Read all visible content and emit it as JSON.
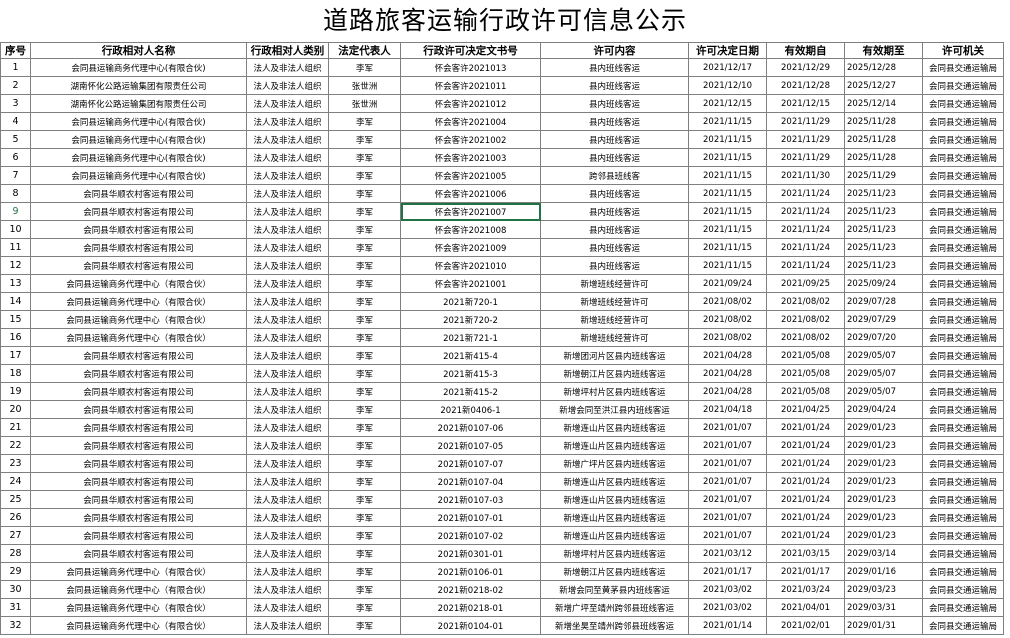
{
  "title": "道路旅客运输行政许可信息公示",
  "headers": [
    "序号",
    "行政相对人名称",
    "行政相对人类别",
    "法定代表人",
    "行政许可决定文书号",
    "许可内容",
    "许可决定日期",
    "有效期自",
    "有效期至",
    "许可机关"
  ],
  "rows": [
    [
      "1",
      "会同县运输商务代理中心(有限合伙)",
      "法人及非法人组织",
      "李军",
      "怀会客许2021013",
      "县内班线客运",
      "2021/12/17",
      "2021/12/29",
      "2025/12/28",
      "会同县交通运输局"
    ],
    [
      "2",
      "湖南怀化公路运输集团有限责任公司",
      "法人及非法人组织",
      "张世洲",
      "怀会客许2021011",
      "县内班线客运",
      "2021/12/10",
      "2021/12/28",
      "2025/12/27",
      "会同县交通运输局"
    ],
    [
      "3",
      "湖南怀化公路运输集团有限责任公司",
      "法人及非法人组织",
      "张世洲",
      "怀会客许2021012",
      "县内班线客运",
      "2021/12/15",
      "2021/12/15",
      "2025/12/14",
      "会同县交通运输局"
    ],
    [
      "4",
      "会同县运输商务代理中心(有限合伙)",
      "法人及非法人组织",
      "李军",
      "怀会客许2021004",
      "县内班线客运",
      "2021/11/15",
      "2021/11/29",
      "2025/11/28",
      "会同县交通运输局"
    ],
    [
      "5",
      "会同县运输商务代理中心(有限合伙)",
      "法人及非法人组织",
      "李军",
      "怀会客许2021002",
      "县内班线客运",
      "2021/11/15",
      "2021/11/29",
      "2025/11/28",
      "会同县交通运输局"
    ],
    [
      "6",
      "会同县运输商务代理中心(有限合伙)",
      "法人及非法人组织",
      "李军",
      "怀会客许2021003",
      "县内班线客运",
      "2021/11/15",
      "2021/11/29",
      "2025/11/28",
      "会同县交通运输局"
    ],
    [
      "7",
      "会同县运输商务代理中心(有限合伙)",
      "法人及非法人组织",
      "李军",
      "怀会客许2021005",
      "跨邻县班线客",
      "2021/11/15",
      "2021/11/30",
      "2025/11/29",
      "会同县交通运输局"
    ],
    [
      "8",
      "会同县华顺农村客运有限公司",
      "法人及非法人组织",
      "李军",
      "怀会客许2021006",
      "县内班线客运",
      "2021/11/15",
      "2021/11/24",
      "2025/11/23",
      "会同县交通运输局"
    ],
    [
      "9",
      "会同县华顺农村客运有限公司",
      "法人及非法人组织",
      "李军",
      "怀会客许2021007",
      "县内班线客运",
      "2021/11/15",
      "2021/11/24",
      "2025/11/23",
      "会同县交通运输局"
    ],
    [
      "10",
      "会同县华顺农村客运有限公司",
      "法人及非法人组织",
      "李军",
      "怀会客许2021008",
      "县内班线客运",
      "2021/11/15",
      "2021/11/24",
      "2025/11/23",
      "会同县交通运输局"
    ],
    [
      "11",
      "会同县华顺农村客运有限公司",
      "法人及非法人组织",
      "李军",
      "怀会客许2021009",
      "县内班线客运",
      "2021/11/15",
      "2021/11/24",
      "2025/11/23",
      "会同县交通运输局"
    ],
    [
      "12",
      "会同县华顺农村客运有限公司",
      "法人及非法人组织",
      "李军",
      "怀会客许2021010",
      "县内班线客运",
      "2021/11/15",
      "2021/11/24",
      "2025/11/23",
      "会同县交通运输局"
    ],
    [
      "13",
      "会同县运输商务代理中心（有限合伙）",
      "法人及非法人组织",
      "李军",
      "怀会客许2021001",
      "新增班线经营许可",
      "2021/09/24",
      "2021/09/25",
      "2025/09/24",
      "会同县交通运输局"
    ],
    [
      "14",
      "会同县运输商务代理中心（有限合伙）",
      "法人及非法人组织",
      "李军",
      "2021新720-1",
      "新增班线经营许可",
      "2021/08/02",
      "2021/08/02",
      "2029/07/28",
      "会同县交通运输局"
    ],
    [
      "15",
      "会同县运输商务代理中心（有限合伙）",
      "法人及非法人组织",
      "李军",
      "2021新720-2",
      "新增班线经营许可",
      "2021/08/02",
      "2021/08/02",
      "2029/07/29",
      "会同县交通运输局"
    ],
    [
      "16",
      "会同县运输商务代理中心（有限合伙）",
      "法人及非法人组织",
      "李军",
      "2021新721-1",
      "新增班线经营许可",
      "2021/08/02",
      "2021/08/02",
      "2029/07/20",
      "会同县交通运输局"
    ],
    [
      "17",
      "会同县华顺农村客运有限公司",
      "法人及非法人组织",
      "李军",
      "2021新415-4",
      "新增团河片区县内班线客运",
      "2021/04/28",
      "2021/05/08",
      "2029/05/07",
      "会同县交通运输局"
    ],
    [
      "18",
      "会同县华顺农村客运有限公司",
      "法人及非法人组织",
      "李军",
      "2021新415-3",
      "新增朝江片区县内班线客运",
      "2021/04/28",
      "2021/05/08",
      "2029/05/07",
      "会同县交通运输局"
    ],
    [
      "19",
      "会同县华顺农村客运有限公司",
      "法人及非法人组织",
      "李军",
      "2021新415-2",
      "新增坪村片区县内班线客运",
      "2021/04/28",
      "2021/05/08",
      "2029/05/07",
      "会同县交通运输局"
    ],
    [
      "20",
      "会同县华顺农村客运有限公司",
      "法人及非法人组织",
      "李军",
      "2021新0406-1",
      "新增会同至洪江县内班线客运",
      "2021/04/18",
      "2021/04/25",
      "2029/04/24",
      "会同县交通运输局"
    ],
    [
      "21",
      "会同县华顺农村客运有限公司",
      "法人及非法人组织",
      "李军",
      "2021新0107-06",
      "新增连山片区县内班线客运",
      "2021/01/07",
      "2021/01/24",
      "2029/01/23",
      "会同县交通运输局"
    ],
    [
      "22",
      "会同县华顺农村客运有限公司",
      "法人及非法人组织",
      "李军",
      "2021新0107-05",
      "新增连山片区县内班线客运",
      "2021/01/07",
      "2021/01/24",
      "2029/01/23",
      "会同县交通运输局"
    ],
    [
      "23",
      "会同县华顺农村客运有限公司",
      "法人及非法人组织",
      "李军",
      "2021新0107-07",
      "新增广坪片区县内班线客运",
      "2021/01/07",
      "2021/01/24",
      "2029/01/23",
      "会同县交通运输局"
    ],
    [
      "24",
      "会同县华顺农村客运有限公司",
      "法人及非法人组织",
      "李军",
      "2021新0107-04",
      "新增连山片区县内班线客运",
      "2021/01/07",
      "2021/01/24",
      "2029/01/23",
      "会同县交通运输局"
    ],
    [
      "25",
      "会同县华顺农村客运有限公司",
      "法人及非法人组织",
      "李军",
      "2021新0107-03",
      "新增连山片区县内班线客运",
      "2021/01/07",
      "2021/01/24",
      "2029/01/23",
      "会同县交通运输局"
    ],
    [
      "26",
      "会同县华顺农村客运有限公司",
      "法人及非法人组织",
      "李军",
      "2021新0107-01",
      "新增连山片区县内班线客运",
      "2021/01/07",
      "2021/01/24",
      "2029/01/23",
      "会同县交通运输局"
    ],
    [
      "27",
      "会同县华顺农村客运有限公司",
      "法人及非法人组织",
      "李军",
      "2021新0107-02",
      "新增连山片区县内班线客运",
      "2021/01/07",
      "2021/01/24",
      "2029/01/23",
      "会同县交通运输局"
    ],
    [
      "28",
      "会同县华顺农村客运有限公司",
      "法人及非法人组织",
      "李军",
      "2021新0301-01",
      "新增坪村片区县内班线客运",
      "2021/03/12",
      "2021/03/15",
      "2029/03/14",
      "会同县交通运输局"
    ],
    [
      "29",
      "会同县运输商务代理中心（有限合伙）",
      "法人及非法人组织",
      "李军",
      "2021新0106-01",
      "新增朝江片区县内班线客运",
      "2021/01/17",
      "2021/01/17",
      "2029/01/16",
      "会同县交通运输局"
    ],
    [
      "30",
      "会同县运输商务代理中心（有限合伙）",
      "法人及非法人组织",
      "李军",
      "2021新0218-02",
      "新增会同至黄茅县内班线客运",
      "2021/03/02",
      "2021/03/24",
      "2029/03/23",
      "会同县交通运输局"
    ],
    [
      "31",
      "会同县运输商务代理中心（有限合伙）",
      "法人及非法人组织",
      "李军",
      "2021新0218-01",
      "新增广坪至靖州跨邻县班线客运",
      "2021/03/02",
      "2021/04/01",
      "2029/03/31",
      "会同县交通运输局"
    ],
    [
      "32",
      "会同县运输商务代理中心（有限合伙）",
      "法人及非法人组织",
      "李军",
      "2021新0104-01",
      "新增坐昊至靖州跨邻县班线客运",
      "2021/01/14",
      "2021/02/01",
      "2029/01/31",
      "会同县交通运输局"
    ]
  ],
  "selected": {
    "row": 8,
    "col": 4
  }
}
